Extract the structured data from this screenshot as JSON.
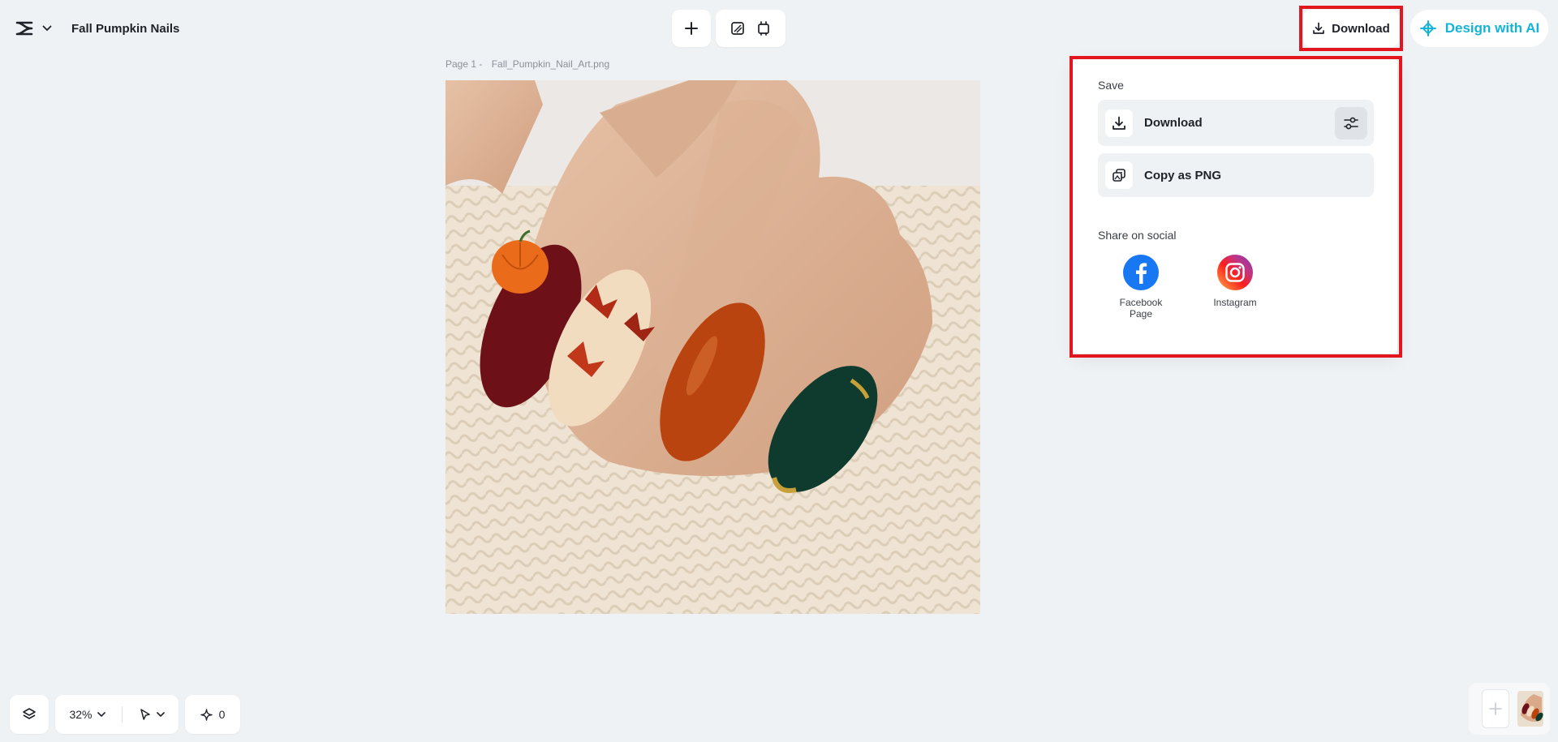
{
  "header": {
    "project_title": "Fall Pumpkin Nails",
    "download_label": "Download",
    "design_ai_label": "Design with AI"
  },
  "canvas": {
    "page_label": "Page 1 -",
    "file_name": "Fall_Pumpkin_Nail_Art.png"
  },
  "dropdown": {
    "save_title": "Save",
    "download_label": "Download",
    "copy_label": "Copy as PNG",
    "share_title": "Share on social",
    "social": [
      {
        "label": "Facebook Page",
        "icon": "facebook-icon"
      },
      {
        "label": "Instagram",
        "icon": "instagram-icon"
      }
    ]
  },
  "footer": {
    "zoom": "32%",
    "credits": "0"
  },
  "colors": {
    "accent": "#14b4d8",
    "highlight": "#e3151f",
    "facebook": "#1877f2"
  }
}
